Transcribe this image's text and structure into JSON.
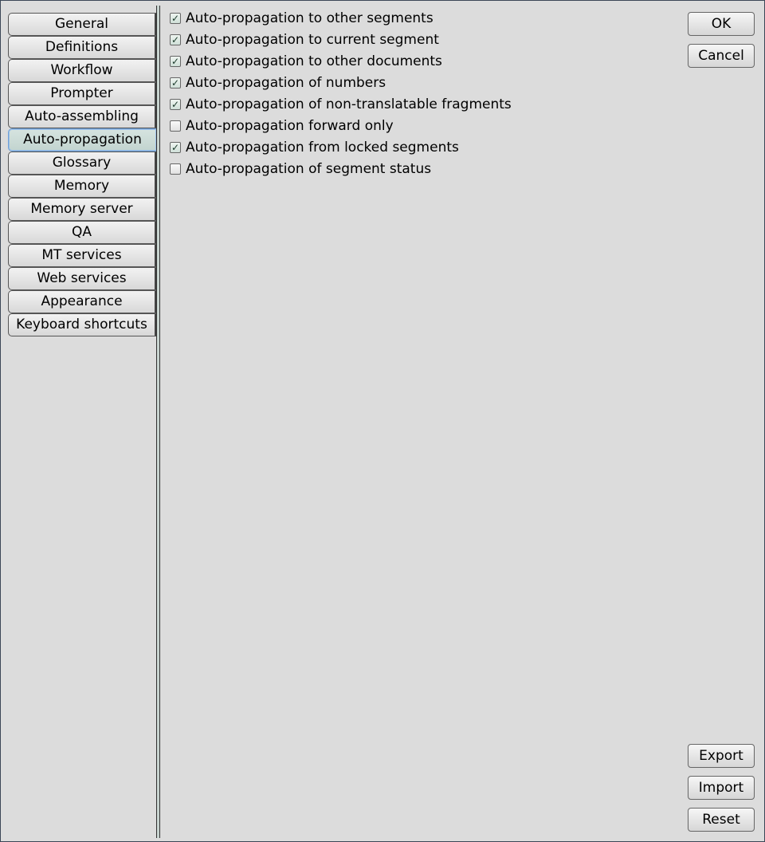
{
  "sidebar": {
    "items": [
      {
        "label": "General",
        "selected": false
      },
      {
        "label": "Definitions",
        "selected": false
      },
      {
        "label": "Workflow",
        "selected": false
      },
      {
        "label": "Prompter",
        "selected": false
      },
      {
        "label": "Auto-assembling",
        "selected": false
      },
      {
        "label": "Auto-propagation",
        "selected": true
      },
      {
        "label": "Glossary",
        "selected": false
      },
      {
        "label": "Memory",
        "selected": false
      },
      {
        "label": "Memory server",
        "selected": false
      },
      {
        "label": "QA",
        "selected": false
      },
      {
        "label": "MT services",
        "selected": false
      },
      {
        "label": "Web services",
        "selected": false
      },
      {
        "label": "Appearance",
        "selected": false
      },
      {
        "label": "Keyboard shortcuts",
        "selected": false
      }
    ]
  },
  "options": [
    {
      "label": "Auto-propagation to other segments",
      "checked": true
    },
    {
      "label": "Auto-propagation to current segment",
      "checked": true
    },
    {
      "label": "Auto-propagation to other documents",
      "checked": true
    },
    {
      "label": "Auto-propagation of numbers",
      "checked": true
    },
    {
      "label": "Auto-propagation of non-translatable fragments",
      "checked": true
    },
    {
      "label": "Auto-propagation forward only",
      "checked": false
    },
    {
      "label": "Auto-propagation from locked segments",
      "checked": true
    },
    {
      "label": "Auto-propagation of segment status",
      "checked": false
    }
  ],
  "buttons": {
    "ok": "OK",
    "cancel": "Cancel",
    "export": "Export",
    "import": "Import",
    "reset": "Reset"
  }
}
